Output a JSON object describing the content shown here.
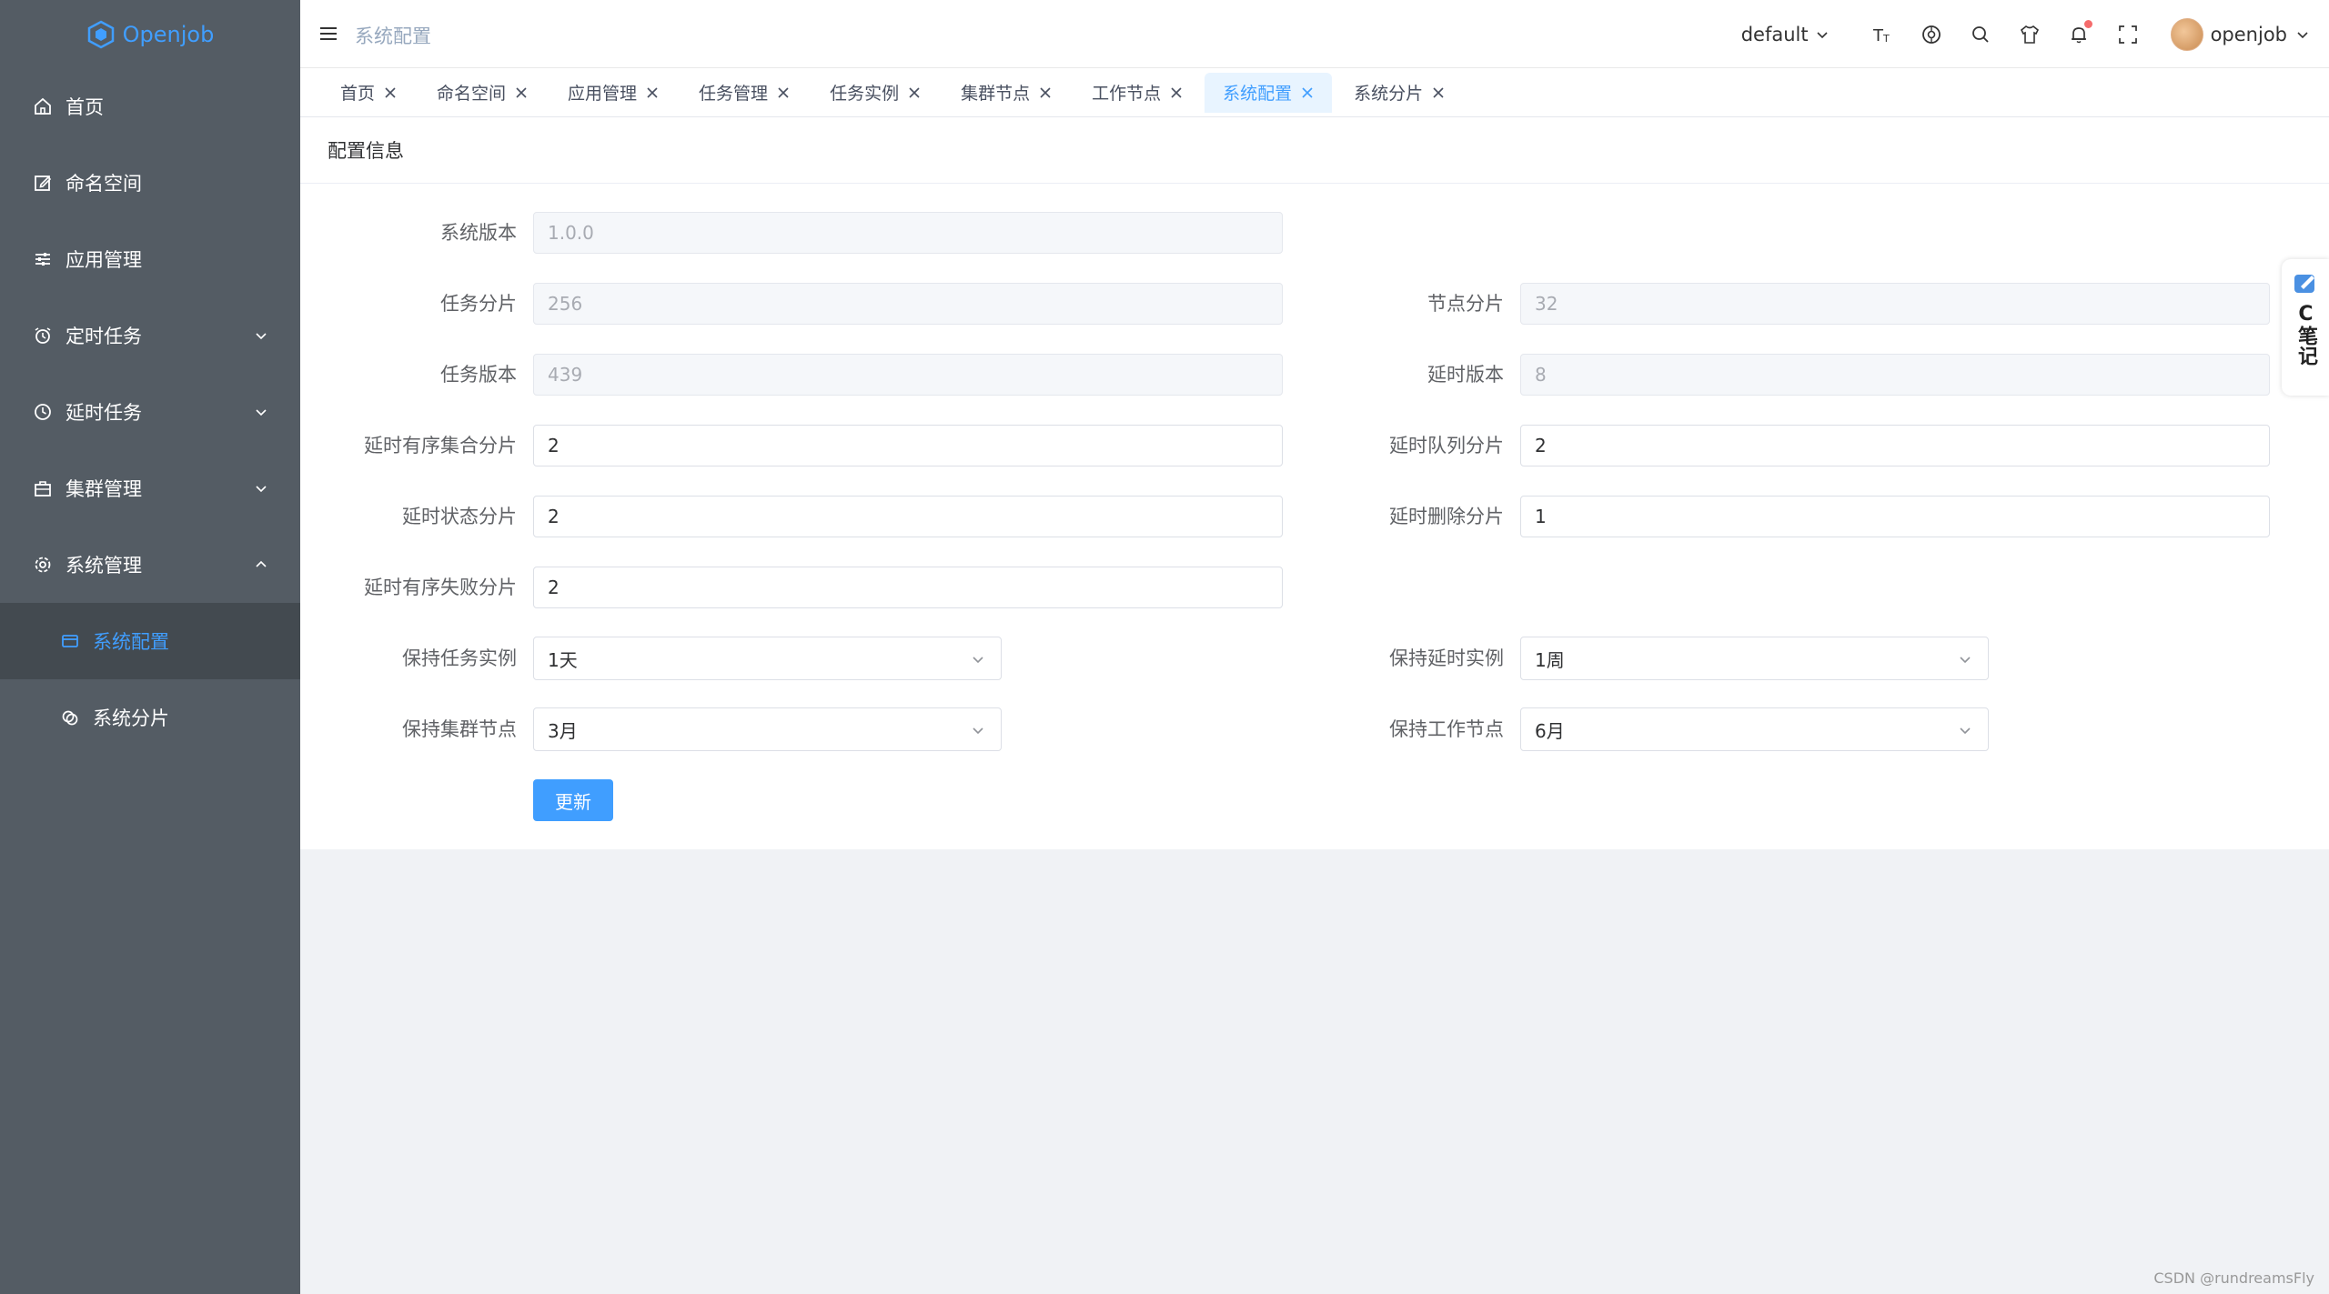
{
  "app": {
    "name": "Openjob"
  },
  "sidebar": {
    "items": [
      {
        "label": "首页",
        "icon": "home-icon"
      },
      {
        "label": "命名空间",
        "icon": "edit-icon"
      },
      {
        "label": "应用管理",
        "icon": "sliders-icon"
      },
      {
        "label": "定时任务",
        "icon": "alarm-icon"
      },
      {
        "label": "延时任务",
        "icon": "clock-icon"
      },
      {
        "label": "集群管理",
        "icon": "briefcase-icon"
      },
      {
        "label": "系统管理",
        "icon": "gear-icon"
      },
      {
        "label": "系统配置",
        "icon": "card-icon"
      },
      {
        "label": "系统分片",
        "icon": "coins-icon"
      }
    ]
  },
  "header": {
    "breadcrumb": "系统配置",
    "namespace": "default",
    "username": "openjob"
  },
  "tabs": [
    {
      "label": "首页"
    },
    {
      "label": "命名空间"
    },
    {
      "label": "应用管理"
    },
    {
      "label": "任务管理"
    },
    {
      "label": "任务实例"
    },
    {
      "label": "集群节点"
    },
    {
      "label": "工作节点"
    },
    {
      "label": "系统配置"
    },
    {
      "label": "系统分片"
    }
  ],
  "card": {
    "title": "配置信息",
    "fields": {
      "system_version": {
        "label": "系统版本",
        "value": "1.0.0"
      },
      "job_slot": {
        "label": "任务分片",
        "value": "256"
      },
      "node_slot": {
        "label": "节点分片",
        "value": "32"
      },
      "job_version": {
        "label": "任务版本",
        "value": "439"
      },
      "delay_version": {
        "label": "延时版本",
        "value": "8"
      },
      "delay_zset_slot": {
        "label": "延时有序集合分片",
        "value": "2"
      },
      "delay_list_slot": {
        "label": "延时队列分片",
        "value": "2"
      },
      "delay_status_slot": {
        "label": "延时状态分片",
        "value": "2"
      },
      "delay_delete_slot": {
        "label": "延时删除分片",
        "value": "1"
      },
      "delay_fail_zset_slot": {
        "label": "延时有序失败分片",
        "value": "2"
      },
      "keep_job_instance": {
        "label": "保持任务实例",
        "value": "1天"
      },
      "keep_delay_instance": {
        "label": "保持延时实例",
        "value": "1周"
      },
      "keep_cluster_node": {
        "label": "保持集群节点",
        "value": "3月"
      },
      "keep_worker_node": {
        "label": "保持工作节点",
        "value": "6月"
      }
    },
    "update_label": "更新"
  },
  "note_widget": {
    "label": "C笔记"
  },
  "watermark": "CSDN @rundreamsFly",
  "colors": {
    "primary": "#409eff",
    "sidebar": "#545c64",
    "sidebar_active": "#434a50"
  }
}
